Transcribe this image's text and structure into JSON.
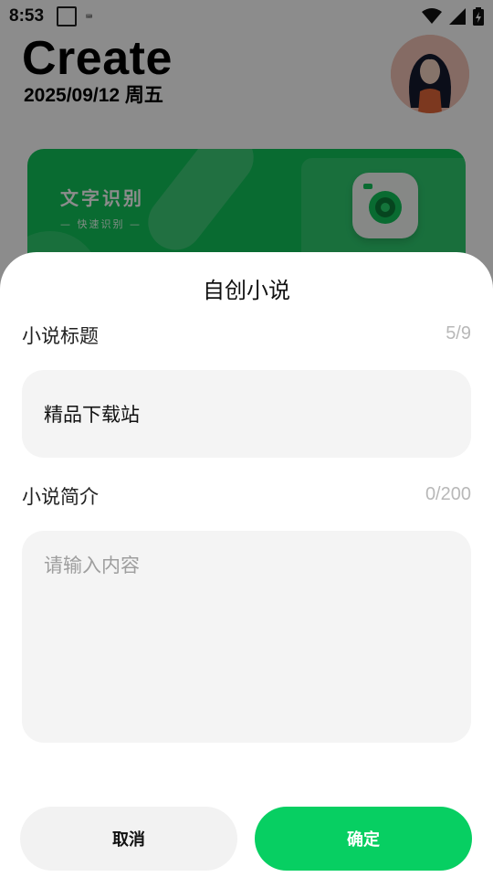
{
  "status_bar": {
    "time": "8:53",
    "keyboard_glyph": "⌨"
  },
  "header": {
    "title": "Create",
    "date": "2025/09/12 周五"
  },
  "feature_card": {
    "title": "文字识别",
    "subtitle": "— 快速识别 —",
    "color": "#12c35a"
  },
  "dialog": {
    "title": "自创小说",
    "title_field": {
      "label": "小说标题",
      "counter": "5/9",
      "value": "精品下载站"
    },
    "intro_field": {
      "label": "小说简介",
      "counter": "0/200",
      "placeholder": "请输入内容"
    },
    "cancel_label": "取消",
    "confirm_label": "确定",
    "accent_color": "#07cf62"
  }
}
